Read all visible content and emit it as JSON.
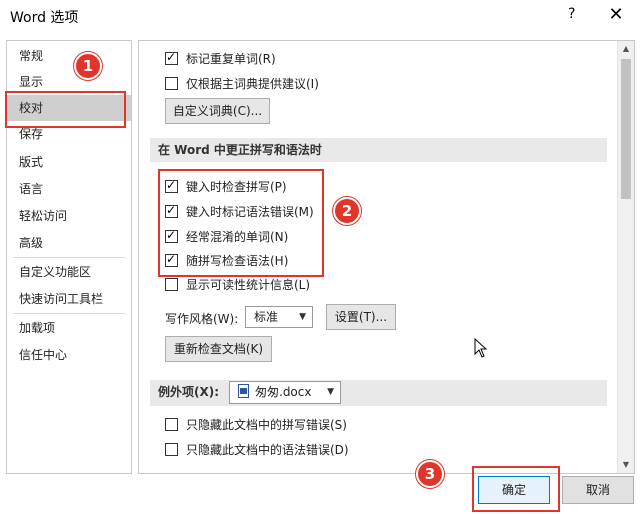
{
  "window": {
    "title": "Word 选项",
    "help_label": "?",
    "close_label": "✕"
  },
  "sidebar": {
    "items": [
      {
        "label": "常规"
      },
      {
        "label": "显示"
      },
      {
        "label": "校对",
        "selected": true
      },
      {
        "label": "保存"
      },
      {
        "label": "版式"
      },
      {
        "label": "语言"
      },
      {
        "label": "轻松访问"
      },
      {
        "label": "高级"
      },
      {
        "label": "自定义功能区"
      },
      {
        "label": "快速访问工具栏"
      },
      {
        "label": "加载项"
      },
      {
        "label": "信任中心"
      }
    ]
  },
  "top_options": {
    "flag_repeated": {
      "label": "标记重复单词(R)",
      "checked": true
    },
    "main_dict_only": {
      "label": "仅根据主词典提供建议(I)",
      "checked": false
    },
    "custom_dict_button": "自定义词典(C)..."
  },
  "spelling_section": {
    "header": "在 Word 中更正拼写和语法时",
    "options": [
      {
        "label": "键入时检查拼写(P)",
        "checked": true
      },
      {
        "label": "键入时标记语法错误(M)",
        "checked": true
      },
      {
        "label": "经常混淆的单词(N)",
        "checked": true
      },
      {
        "label": "随拼写检查语法(H)",
        "checked": true
      },
      {
        "label": "显示可读性统计信息(L)",
        "checked": false
      }
    ],
    "writing_style_label": "写作风格(W):",
    "writing_style_value": "标准",
    "settings_button": "设置(T)...",
    "recheck_button": "重新检查文档(K)"
  },
  "exceptions": {
    "label": "例外项(X):",
    "document": "匆匆.docx",
    "options": [
      {
        "label": "只隐藏此文档中的拼写错误(S)",
        "checked": false
      },
      {
        "label": "只隐藏此文档中的语法错误(D)",
        "checked": false
      }
    ]
  },
  "footer": {
    "ok_button": "确定",
    "cancel_button": "取消"
  },
  "annotations": {
    "badge1": "1",
    "badge2": "2",
    "badge3": "3"
  },
  "colors": {
    "annotation": "#e0352b",
    "selected_nav": "#cfcfcf",
    "primary_border": "#0078d7"
  }
}
